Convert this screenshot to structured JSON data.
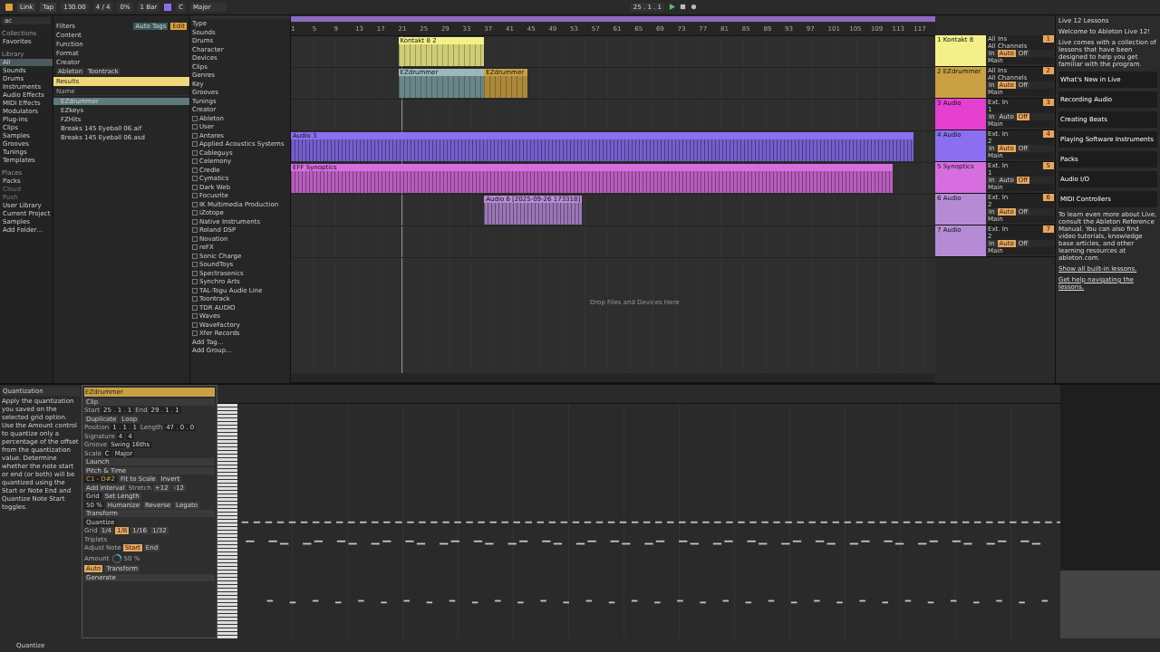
{
  "transport": {
    "buttons": [
      "Link",
      "Tap"
    ],
    "tempo": "130.00",
    "signature": "4 / 4",
    "swing": "0%",
    "quantize": "1 Bar",
    "key": "C",
    "scale": "Major",
    "position": "25 . 1 . 1"
  },
  "browser": {
    "search": "ac",
    "collections_title": "Collections",
    "collections": [
      {
        "label": "Favorites",
        "selected": false
      }
    ],
    "library_title": "Library",
    "library": [
      {
        "label": "All",
        "selected": true
      },
      {
        "label": "Sounds",
        "selected": false
      },
      {
        "label": "Drums",
        "selected": false
      },
      {
        "label": "Instruments",
        "selected": false
      },
      {
        "label": "Audio Effects",
        "selected": false
      },
      {
        "label": "MIDI Effects",
        "selected": false
      },
      {
        "label": "Modulators",
        "selected": false
      },
      {
        "label": "Plug-ins",
        "selected": false
      },
      {
        "label": "Clips",
        "selected": false
      },
      {
        "label": "Samples",
        "selected": false
      },
      {
        "label": "Grooves",
        "selected": false
      },
      {
        "label": "Tunings",
        "selected": false
      },
      {
        "label": "Templates",
        "selected": false
      }
    ],
    "places_title": "Places",
    "places": [
      {
        "label": "Packs",
        "disabled": false
      },
      {
        "label": "Cloud",
        "disabled": true
      },
      {
        "label": "Push",
        "disabled": true
      },
      {
        "label": "User Library",
        "disabled": false
      },
      {
        "label": "Current Project",
        "disabled": false
      },
      {
        "label": "Samples",
        "disabled": false
      },
      {
        "label": "Add Folder…",
        "disabled": false
      }
    ],
    "filters_label": "Filters",
    "auto_tags": "Auto Tags",
    "edit_badge": "Edit",
    "filter_rows": [
      "Content",
      "Function",
      "Format",
      "Creator"
    ],
    "chips": [
      "Ableton",
      "Toontrack"
    ],
    "results_label": "Results",
    "name_header": "Name",
    "results": [
      {
        "name": "EZdrummer",
        "selected": true
      },
      {
        "name": "EZkeys",
        "selected": false
      },
      {
        "name": "FZHits",
        "selected": false
      },
      {
        "name": "Breaks 145 Eyeball 06.aif",
        "selected": false
      },
      {
        "name": "Breaks 145 Eyeball 06.asd",
        "selected": false
      }
    ],
    "tag_groups": [
      "Type",
      "Sounds",
      "Drums",
      "Character",
      "Devices",
      "Clips",
      "Genres",
      "Key",
      "Grooves",
      "Tunings",
      "Creator"
    ],
    "creators": [
      {
        "name": "Ableton",
        "checked": false
      },
      {
        "name": "User",
        "checked": false
      },
      {
        "name": "Antares",
        "checked": false
      },
      {
        "name": "Applied Acoustics Systems",
        "checked": false
      },
      {
        "name": "Cableguys",
        "checked": false
      },
      {
        "name": "Celemony",
        "checked": false
      },
      {
        "name": "Credle",
        "checked": false
      },
      {
        "name": "Cymatics",
        "checked": false
      },
      {
        "name": "Dark Web",
        "checked": false
      },
      {
        "name": "Focusrite",
        "checked": false
      },
      {
        "name": "IK Multimedia Production",
        "checked": false
      },
      {
        "name": "iZotope",
        "checked": false
      },
      {
        "name": "Native Instruments",
        "checked": false
      },
      {
        "name": "Roland DSP",
        "checked": false
      },
      {
        "name": "Novation",
        "checked": false
      },
      {
        "name": "reFX",
        "checked": false
      },
      {
        "name": "Sonic Charge",
        "checked": false
      },
      {
        "name": "SoundToys",
        "checked": false
      },
      {
        "name": "Spectrasonics",
        "checked": false
      },
      {
        "name": "Synchro Arts",
        "checked": false
      },
      {
        "name": "TAL-Togu Audio Line",
        "checked": false
      },
      {
        "name": "Toontrack",
        "checked": false
      },
      {
        "name": "TDR AUDIO",
        "checked": false
      },
      {
        "name": "Waves",
        "checked": false
      },
      {
        "name": "WaveFactory",
        "checked": false
      },
      {
        "name": "Xfer Records",
        "checked": false
      }
    ],
    "add_tag": "Add Tag…",
    "add_group": "Add Group…"
  },
  "arrangement": {
    "ruler": [
      "1",
      "5",
      "9",
      "13",
      "17",
      "21",
      "25",
      "29",
      "33",
      "37",
      "41",
      "45",
      "49",
      "53",
      "57",
      "61",
      "65",
      "69",
      "73",
      "77",
      "81",
      "85",
      "89",
      "93",
      "97",
      "101",
      "105",
      "109",
      "113",
      "117"
    ],
    "drop_hint": "Drop Files and Devices Here",
    "tracks": [
      {
        "name": "1 Kontakt 8",
        "color": "#f3f08a",
        "input": "All Ins",
        "channel": "All Channels",
        "monitor": [
          {
            "label": "In",
            "selected": false
          },
          {
            "label": "Auto",
            "selected": true
          },
          {
            "label": "Off",
            "selected": false
          }
        ],
        "output": "Main",
        "number": "1",
        "clips": [
          {
            "name": "Kontakt 8 2",
            "kind": "midi",
            "selected": false
          }
        ]
      },
      {
        "name": "2 EZdrummer",
        "color": "#c9a043",
        "input": "All Ins",
        "channel": "All Channels",
        "monitor": [
          {
            "label": "In",
            "selected": false
          },
          {
            "label": "Auto",
            "selected": true
          },
          {
            "label": "Off",
            "selected": false
          }
        ],
        "output": "Main",
        "number": "2",
        "clips": [
          {
            "name": "EZdrummer",
            "kind": "midi",
            "selected": true
          },
          {
            "name": "EZdrummer",
            "kind": "midi",
            "selected": false
          }
        ]
      },
      {
        "name": "3 Audio",
        "color": "#e53fd0",
        "input": "Ext. In",
        "channel": "1",
        "monitor": [
          {
            "label": "In",
            "selected": false
          },
          {
            "label": "Auto",
            "selected": false
          },
          {
            "label": "Off",
            "selected": true
          }
        ],
        "output": "Main",
        "number": "3"
      },
      {
        "name": "4 Audio",
        "color": "#8a6ff0",
        "input": "Ext. In",
        "channel": "2",
        "monitor": [
          {
            "label": "In",
            "selected": false
          },
          {
            "label": "Auto",
            "selected": true
          },
          {
            "label": "Off",
            "selected": false
          }
        ],
        "output": "Main",
        "number": "4",
        "clips": [
          {
            "name": "Audio 3",
            "kind": "audio",
            "selected": false
          }
        ]
      },
      {
        "name": "5 Synoptics",
        "color": "#d76ee0",
        "input": "Ext. In",
        "channel": "1",
        "monitor": [
          {
            "label": "In",
            "selected": false
          },
          {
            "label": "Auto",
            "selected": false
          },
          {
            "label": "Off",
            "selected": true
          }
        ],
        "output": "Main",
        "number": "5",
        "clips": [
          {
            "name": "EFF Synoptics",
            "kind": "audio",
            "selected": false
          }
        ]
      },
      {
        "name": "6 Audio",
        "color": "#b58bd6",
        "input": "Ext. In",
        "channel": "2",
        "monitor": [
          {
            "label": "In",
            "selected": false
          },
          {
            "label": "Auto",
            "selected": true
          },
          {
            "label": "Off",
            "selected": false
          }
        ],
        "output": "Main",
        "number": "6",
        "clips": [
          {
            "name": "Audio 6 [2025-09-26 173318]",
            "kind": "audio",
            "selected": false
          }
        ]
      },
      {
        "name": "7 Audio",
        "color": "#b58bd6",
        "input": "Ext. In",
        "channel": "2",
        "monitor": [
          {
            "label": "In",
            "selected": false
          },
          {
            "label": "Auto",
            "selected": true
          },
          {
            "label": "Off",
            "selected": false
          }
        ],
        "output": "Main",
        "number": "7"
      }
    ]
  },
  "lessons": {
    "title": "Live 12 Lessons",
    "welcome": "Welcome to Ableton Live 12!",
    "intro": "Live comes with a collection of lessons that have been designed to help you get familiar with the program.",
    "items": [
      "What's New in Live",
      "Recording Audio",
      "Creating Beats",
      "Playing Software Instruments",
      "Packs",
      "Audio I/O",
      "MIDI Controllers"
    ],
    "footer": "To learn even more about Live, consult the Ableton Reference Manual. You can also find video tutorials, knowledge base articles, and other learning resources at ableton.com.",
    "show_all": "Show all built-in lessons.",
    "help": "Get help navigating the lessons."
  },
  "info": {
    "title": "Quantization",
    "text": "Apply the quantization you saved on the selected grid option. Use the Amount control to quantize only a percentage of the offset from the quantization value. Determine whether the note start or end (or both) will be quantized using the Start or Note End and Quantize Note Start toggles."
  },
  "clip": {
    "title": "EZdrummer",
    "sections": [
      "Clip",
      "Launch",
      "Pitch & Time",
      "Transform",
      "Generate"
    ],
    "start_label": "Start",
    "end_label": "End",
    "start": "25 . 1 . 1",
    "end": "29 . 1 . 1",
    "duplicate": "Duplicate",
    "loop": "Loop",
    "position_label": "Position",
    "length_label": "Length",
    "position": "1 . 1 . 1",
    "length": "47 . 0 . 0",
    "signature_label": "Signature",
    "groove_label": "Groove",
    "sig_num": "4",
    "sig_den": "4",
    "groove": "Swing 16ths",
    "scale_label": "Scale",
    "key": "C",
    "scale": "Major",
    "range": "C1 - D#2",
    "fit": "Fit to Scale",
    "invert": "Invert",
    "add_interval": "Add Interval",
    "stretch": "Stretch",
    "up": "+12",
    "down": "-12",
    "grid": "Grid",
    "set_length": "Set Length",
    "percent": "50 %",
    "humanize": "Humanize",
    "reverse": "Reverse",
    "legato": "Legato",
    "transform_mode": "Quantize",
    "grid_label": "Grid",
    "grid_options": [
      {
        "label": "1/4",
        "selected": false
      },
      {
        "label": "1/8",
        "selected": true
      },
      {
        "label": "1/16",
        "selected": false
      },
      {
        "label": "1/32",
        "selected": false
      }
    ],
    "triplets": "Triplets",
    "adjust": "Adjust Note",
    "adjust_options": [
      {
        "label": "Start",
        "selected": true
      },
      {
        "label": "End",
        "selected": false
      }
    ],
    "amount": "Amount",
    "amount_value": "50 %",
    "auto": "Auto",
    "transform": "Transform"
  },
  "status": "Quantize"
}
